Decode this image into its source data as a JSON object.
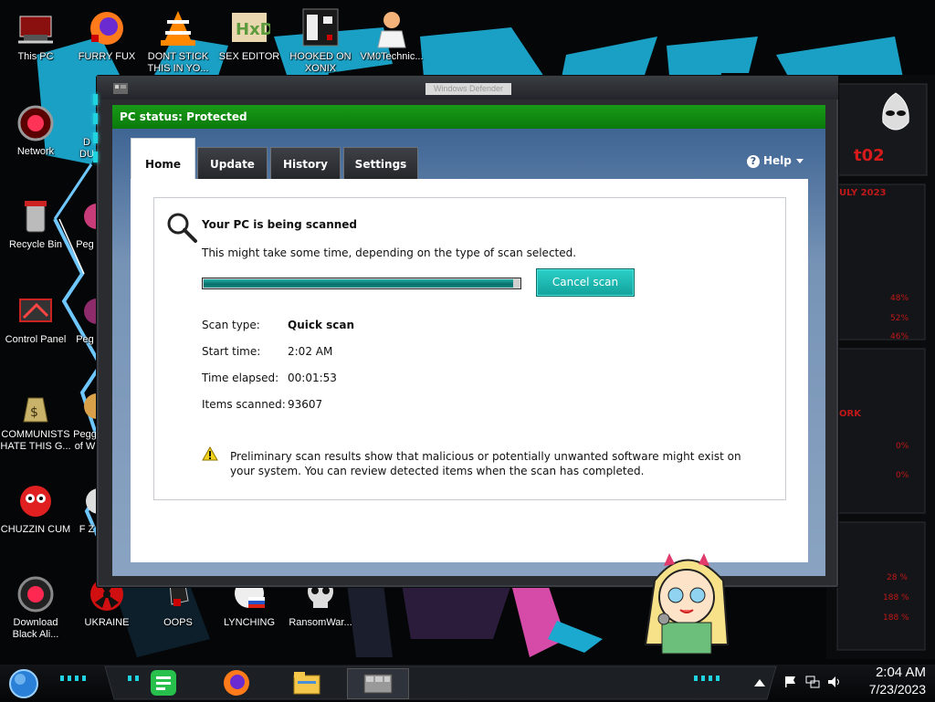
{
  "desktop": {
    "icons_col1": [
      {
        "label": "This PC",
        "glyph": "computer-icon"
      },
      {
        "label": "Network",
        "glyph": "network-icon"
      },
      {
        "label": "Recycle Bin",
        "glyph": "recycle-bin-icon"
      },
      {
        "label": "Control Panel",
        "glyph": "control-panel-icon"
      },
      {
        "label": "COMMUNISTS HATE THIS G...",
        "glyph": "money-bag-icon"
      },
      {
        "label": "CHUZZIN CUM",
        "glyph": "chuzzle-icon"
      },
      {
        "label": "Download Black Ali...",
        "glyph": "alien-orb-icon"
      }
    ],
    "icons_top": [
      {
        "label": "FURRY FUX",
        "glyph": "firefox-icon"
      },
      {
        "label": "DONT STICK THIS IN YO...",
        "glyph": "vlc-icon"
      },
      {
        "label": "SEX EDITOR",
        "glyph": "hxd-icon"
      },
      {
        "label": "HOOKED ON XONIX",
        "glyph": "xonix-icon"
      },
      {
        "label": "VM0Technic...",
        "glyph": "doctor-icon"
      }
    ],
    "icons_bottom": [
      {
        "label": "UKRAINE",
        "glyph": "radiation-icon"
      },
      {
        "label": "OOPS",
        "glyph": "glitch-icon"
      },
      {
        "label": "LYNCHING",
        "glyph": "flag-icon"
      },
      {
        "label": "RansomWar...",
        "glyph": "skull-icon"
      }
    ],
    "partial_labels": [
      "Peg",
      "Peg",
      "Peg",
      "Pegg of W",
      "F Z",
      "D DU"
    ]
  },
  "defender": {
    "window_title": "Windows Defender",
    "status": "PC status: Protected",
    "tabs": [
      "Home",
      "Update",
      "History",
      "Settings"
    ],
    "active_tab": "Home",
    "help_label": "Help",
    "scan": {
      "title": "Your PC is being scanned",
      "subtitle": "This might take some time, depending on the type of scan selected.",
      "progress_fraction": 0.98,
      "cancel_label": "Cancel scan",
      "details": [
        {
          "label": "Scan type:",
          "value": "Quick scan",
          "bold": true
        },
        {
          "label": "Start time:",
          "value": "2:02 AM",
          "bold": false
        },
        {
          "label": "Time elapsed:",
          "value": "00:01:53",
          "bold": false
        },
        {
          "label": "Items scanned:",
          "value": "93607",
          "bold": false
        }
      ],
      "warning": "Preliminary scan results show that malicious or potentially unwanted software might exist on your system. You can review detected items when the scan has completed."
    }
  },
  "hud": {
    "header": "t02",
    "date": "ULY 2023",
    "percents": [
      "48%",
      "52%",
      "46%"
    ],
    "labels": [
      "ORK",
      "0%",
      "0%"
    ],
    "bottom_rows": [
      "28 %",
      "188 %",
      "188 %"
    ]
  },
  "taskbar": {
    "time": "2:04 AM",
    "date": "7/23/2023",
    "accent": "#1fd3e0",
    "apps": [
      "start-orb-icon",
      "notes-app-icon",
      "firefox-icon",
      "file-explorer-icon",
      "defender-taskbar-icon"
    ]
  },
  "colors": {
    "status_green": "#148f14",
    "progress_teal": "#13918b",
    "cancel_teal": "#1ec0b8",
    "wallpaper_cyan": "#1ca9d0"
  }
}
